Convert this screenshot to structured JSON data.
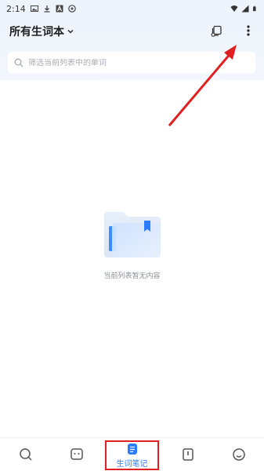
{
  "status_bar": {
    "time": "2:14"
  },
  "header": {
    "title": "所有生词本",
    "search_placeholder": "筛选当前列表中的单词"
  },
  "empty_state": {
    "text": "当前列表暂无内容"
  },
  "tabbar": {
    "tabs": [
      {
        "name": "search"
      },
      {
        "name": "chat"
      },
      {
        "name": "notebook",
        "label": "生词笔记",
        "active": true
      },
      {
        "name": "book"
      },
      {
        "name": "profile"
      }
    ]
  },
  "colors": {
    "accent": "#2b7cff",
    "annotation": "#e02020",
    "header_bg": "#eef4fc"
  }
}
